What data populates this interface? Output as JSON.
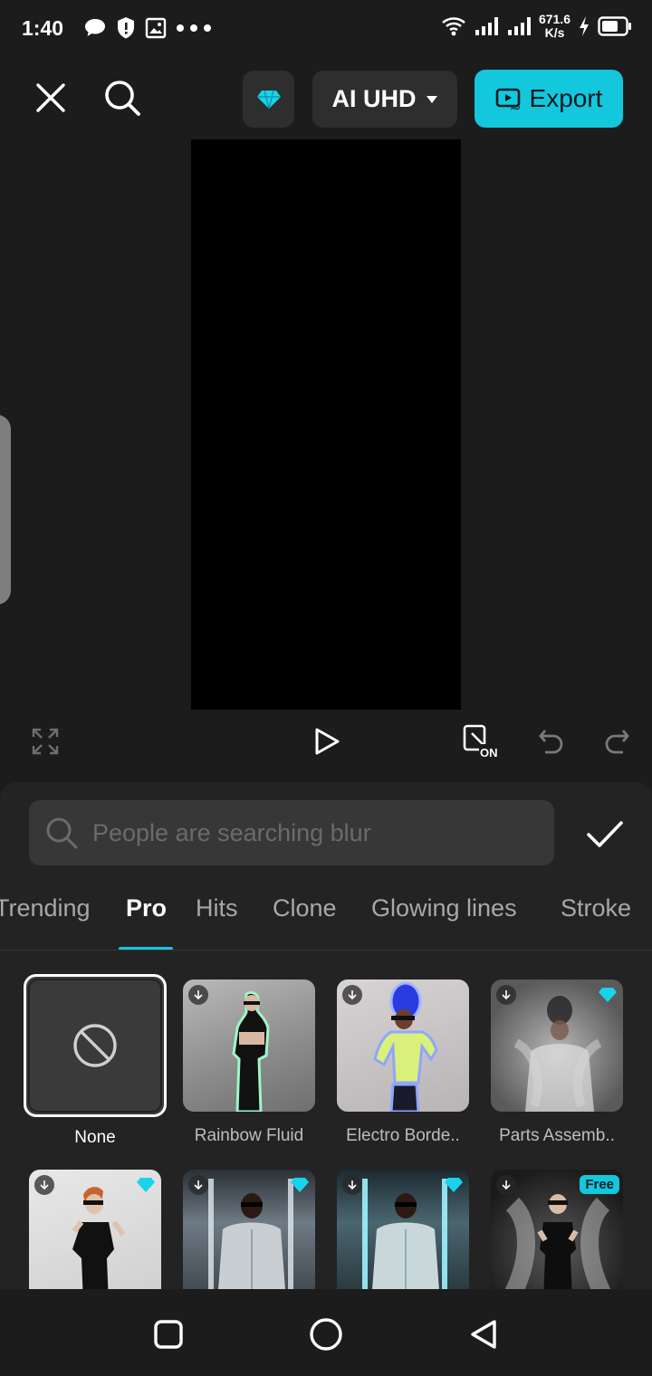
{
  "status": {
    "time": "1:40",
    "speed_value": "671.6",
    "speed_unit": "K/s",
    "icons": [
      "chat-icon",
      "shield-icon",
      "image-icon",
      "more-icon",
      "wifi-icon",
      "signal-icon",
      "signal-icon",
      "charging-icon",
      "battery-icon"
    ]
  },
  "toolbar": {
    "resolution_label": "AI UHD",
    "export_label": "Export"
  },
  "search": {
    "placeholder": "People are searching blur"
  },
  "tabs": [
    "Trending",
    "Pro",
    "Hits",
    "Clone",
    "Glowing lines",
    "Stroke"
  ],
  "active_tab": "Pro",
  "effects_row1": [
    {
      "label": "None"
    },
    {
      "label": "Rainbow Fluid",
      "download": true
    },
    {
      "label": "Electro Borde..",
      "download": true
    },
    {
      "label": "Parts Assemb..",
      "download": true,
      "pro": true
    }
  ],
  "effects_row2": [
    {
      "download": true,
      "pro": true
    },
    {
      "download": true,
      "pro": true
    },
    {
      "download": true,
      "pro": true
    },
    {
      "download": true,
      "badge": "Free"
    }
  ],
  "colors": {
    "accent": "#13c7dc",
    "background": "#1c1c1c",
    "panel": "#232323"
  }
}
